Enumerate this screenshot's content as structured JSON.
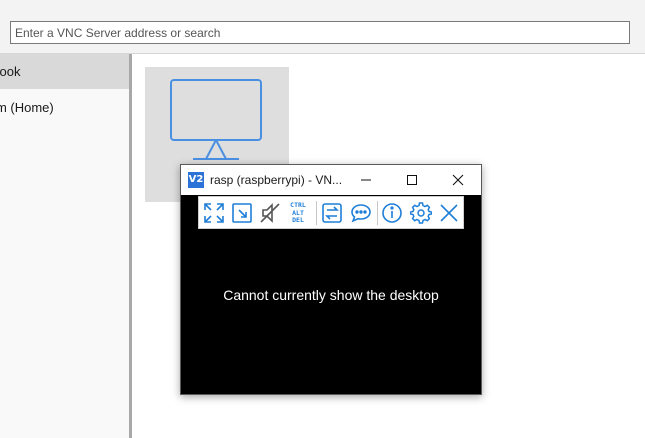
{
  "search": {
    "placeholder": "Enter a VNC Server address or search"
  },
  "sidebar": {
    "items": [
      {
        "label": "Address book",
        "selected": true
      },
      {
        "label": "Team (Home)",
        "selected": false
      }
    ]
  },
  "viewer": {
    "title": "rasp (raspberrypi) - VN...",
    "app_icon_text": "V2",
    "ctrl_alt_del": {
      "line1": "CTRL",
      "line2": "ALT",
      "line3": "DEL"
    },
    "status": "Cannot currently show the desktop"
  },
  "icons": {
    "thumbnail": "monitor-icon",
    "toolbar": [
      "fullscreen-icon",
      "scale-icon",
      "mute-icon",
      "ctrl-alt-del-icon",
      "transfer-files-icon",
      "chat-icon",
      "info-icon",
      "settings-icon",
      "close-icon"
    ],
    "window": [
      "minimize-icon",
      "maximize-icon",
      "close-icon"
    ]
  },
  "colors": {
    "accent": "#1f7fd8",
    "monitor": "#4a90e2",
    "selected": "#d9d9d9"
  }
}
